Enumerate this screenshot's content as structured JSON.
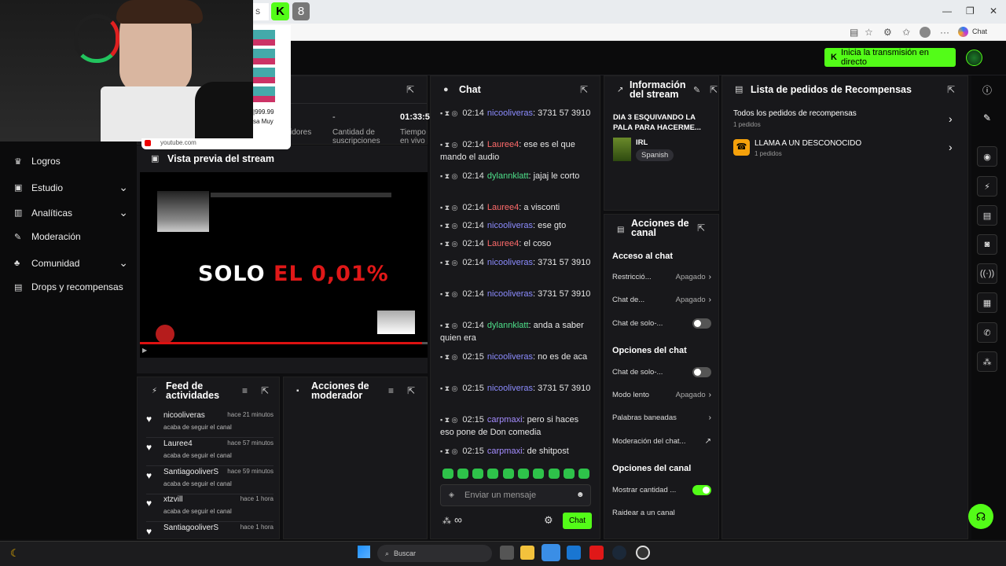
{
  "browser": {
    "tab_badge": "8",
    "tab_partial": "S",
    "chat_label": "Chat"
  },
  "header": {
    "go_live": "Inicia la transmisión en directo"
  },
  "nav": {
    "items": [
      {
        "label": "Logros",
        "icon": "trophy-icon",
        "chevron": false
      },
      {
        "label": "Estudio",
        "icon": "studio-icon",
        "chevron": true
      },
      {
        "label": "Analíticas",
        "icon": "chart-icon",
        "chevron": true
      },
      {
        "label": "Moderación",
        "icon": "wrench-icon",
        "chevron": false
      },
      {
        "label": "Comunidad",
        "icon": "community-icon",
        "chevron": true
      },
      {
        "label": "Drops y recompensas",
        "icon": "gift-icon",
        "chevron": false
      }
    ]
  },
  "stats": {
    "col1_label": "idores",
    "col2_value": "-",
    "col2_label": "Cantidad de suscripciones",
    "col3_value": "01:33:5",
    "col3_label": "Tiempo en vivo"
  },
  "overlay": {
    "yt_price": "|999.99",
    "yt_text": "sa Muy",
    "yt_domain": "youtube.com"
  },
  "preview": {
    "title": "Vista previa del stream",
    "video_text_white": "SOLO",
    "video_text_red": "EL 0,01%"
  },
  "feed": {
    "title": "Feed de actividades",
    "items": [
      {
        "name": "nicooliveras",
        "time": "hace 21 minutos",
        "desc": "acaba de seguir el canal"
      },
      {
        "name": "Lauree4",
        "time": "hace 57 minutos",
        "desc": "acaba de seguir el canal"
      },
      {
        "name": "SantiagooliverS",
        "time": "hace 59 minutos",
        "desc": "acaba de seguir el canal"
      },
      {
        "name": "xtzvill",
        "time": "hace 1 hora",
        "desc": "acaba de seguir el canal"
      },
      {
        "name": "SantiagooliverS",
        "time": "hace 1 hora",
        "desc": ""
      }
    ]
  },
  "modactions": {
    "title": "Acciones de moderador"
  },
  "chat": {
    "title": "Chat",
    "messages": [
      {
        "time": "02:14",
        "user": "nicooliveras",
        "cls": "u1",
        "text": ": 3731 57 3910"
      },
      {
        "time": "02:14",
        "user": "Lauree4",
        "cls": "u2",
        "text": ": ese es el que mando el audio"
      },
      {
        "time": "02:14",
        "user": "dylannklatt",
        "cls": "u3",
        "text": ": jajaj le corto"
      },
      {
        "time": "02:14",
        "user": "Lauree4",
        "cls": "u2",
        "text": ": a visconti"
      },
      {
        "time": "02:14",
        "user": "nicooliveras",
        "cls": "u1",
        "text": ": ese gto"
      },
      {
        "time": "02:14",
        "user": "Lauree4",
        "cls": "u2",
        "text": ": el coso"
      },
      {
        "time": "02:14",
        "user": "nicooliveras",
        "cls": "u1",
        "text": ": 3731 57 3910"
      },
      {
        "time": "02:14",
        "user": "nicooliveras",
        "cls": "u1",
        "text": ": 3731 57 3910"
      },
      {
        "time": "02:14",
        "user": "dylannklatt",
        "cls": "u3",
        "text": ": anda a saber quien era"
      },
      {
        "time": "02:15",
        "user": "nicooliveras",
        "cls": "u1",
        "text": ": no es de aca"
      },
      {
        "time": "02:15",
        "user": "nicooliveras",
        "cls": "u1",
        "text": ": 3731 57 3910"
      },
      {
        "time": "02:15",
        "user": "carpmaxi",
        "cls": "u4",
        "text": ": pero si haces eso pone de Don comedia"
      },
      {
        "time": "02:15",
        "user": "carpmaxi",
        "cls": "u4",
        "text": ": de shitpost"
      }
    ],
    "input_placeholder": "Enviar un mensaje",
    "send_label": "Chat",
    "infinity": "∞"
  },
  "stream_info": {
    "title": "Información del stream",
    "stream_title": "DIA 3 ESQUIVANDO LA PALA PARA HACERME...",
    "category": "IRL",
    "language": "Spanish"
  },
  "channel_actions": {
    "title": "Acciones de canal",
    "section1": "Acceso al chat",
    "rows1": [
      {
        "label": "Restricció...",
        "value": "Apagado"
      },
      {
        "label": "Chat de...",
        "value": "Apagado"
      },
      {
        "label": "Chat de solo-...",
        "value": ""
      }
    ],
    "section2": "Opciones del chat",
    "rows2": [
      {
        "label": "Chat de solo-...",
        "value": ""
      },
      {
        "label": "Modo lento",
        "value": "Apagado"
      },
      {
        "label": "Palabras baneadas",
        "value": ""
      },
      {
        "label": "Moderación del chat...",
        "value": ""
      }
    ],
    "section3": "Opciones del canal",
    "rows3": [
      {
        "label": "Mostrar cantidad ...",
        "value": ""
      },
      {
        "label": "Raidear a un canal",
        "value": ""
      }
    ]
  },
  "rewards": {
    "title": "Lista de pedidos de Recompensas",
    "all_label": "Todos los pedidos de recompensas",
    "all_count": "1 pedidos",
    "item_label": "LLAMA A UN DESCONOCIDO",
    "item_count": "1 pedidos"
  },
  "taskbar": {
    "search": "Buscar"
  }
}
